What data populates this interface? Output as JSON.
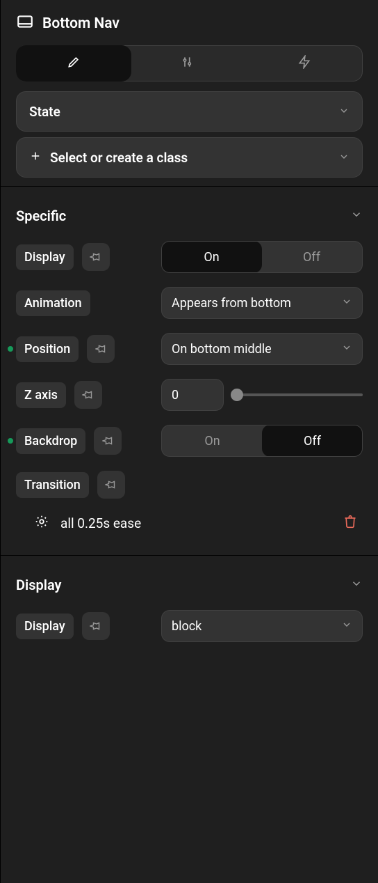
{
  "header": {
    "title": "Bottom Nav"
  },
  "tabs": {
    "active": 0
  },
  "state_dropdown": {
    "label": "State"
  },
  "class_dropdown": {
    "label": "Select or create a class"
  },
  "sections": {
    "specific": {
      "title": "Specific",
      "display": {
        "label": "Display",
        "on": "On",
        "off": "Off",
        "value": "On"
      },
      "animation": {
        "label": "Animation",
        "value": "Appears from bottom"
      },
      "position": {
        "label": "Position",
        "value": "On bottom middle",
        "indicator": true
      },
      "zaxis": {
        "label": "Z axis",
        "value": "0"
      },
      "backdrop": {
        "label": "Backdrop",
        "on": "On",
        "off": "Off",
        "value": "Off",
        "indicator": true
      },
      "transition": {
        "label": "Transition",
        "entry": "all 0.25s ease"
      }
    },
    "display": {
      "title": "Display",
      "display": {
        "label": "Display",
        "value": "block"
      }
    }
  }
}
